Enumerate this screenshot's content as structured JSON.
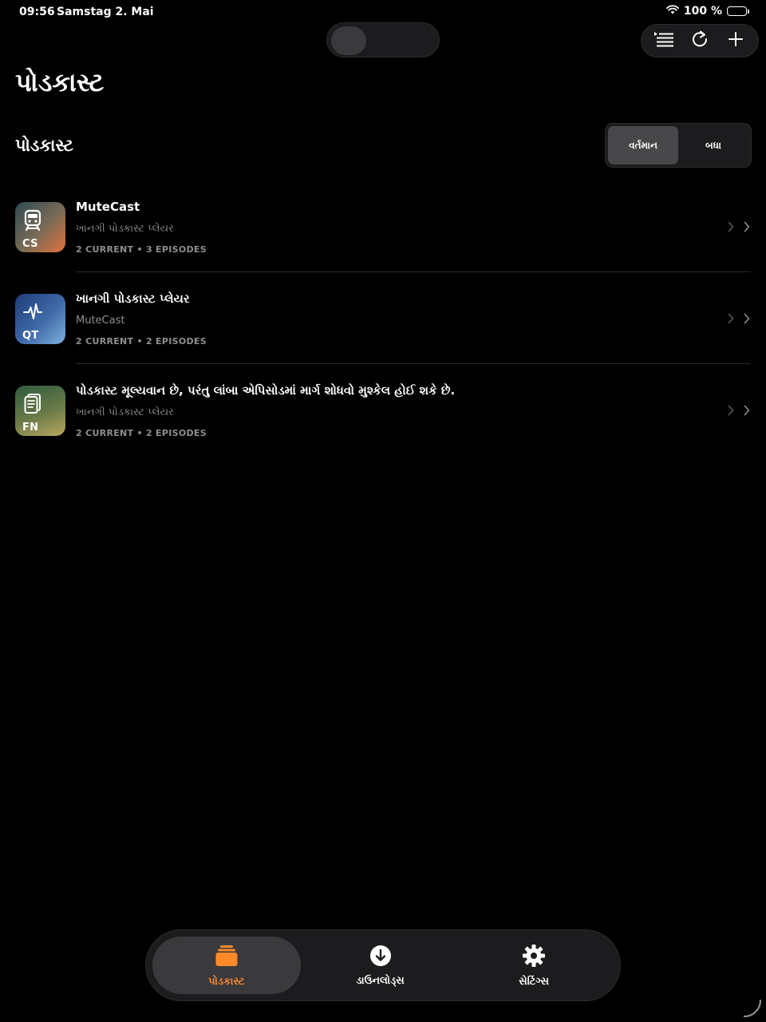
{
  "status_bar": {
    "time": "09:56",
    "date": "Samstag 2. Mai",
    "battery": "100 %"
  },
  "toolbar": {
    "icons": [
      "list-icon",
      "refresh-icon",
      "plus-icon"
    ]
  },
  "page": {
    "title": "પોડકાસ્ટ"
  },
  "section": {
    "title": "પોડકાસ્ટ",
    "segments": [
      {
        "label": "વર્તમાન",
        "active": true
      },
      {
        "label": "બધા",
        "active": false
      }
    ]
  },
  "podcasts": [
    {
      "title": "MuteCast",
      "subtitle": "ખાનગી પોડકાસ્ટ પ્લેયર",
      "meta": "2 CURRENT • 3 EPISODES",
      "art_code": "CS",
      "art_icon": "train-icon"
    },
    {
      "title": "ખાનગી પોડકાસ્ટ પ્લેયર",
      "subtitle": "MuteCast",
      "meta": "2 CURRENT • 2 EPISODES",
      "art_code": "QT",
      "art_icon": "waveform-icon"
    },
    {
      "title": "પોડકાસ્ટ મૂલ્યવાન છે, પરંતુ લાંબા એપિસોડમાં માર્ગ શોધવો મુશ્કેલ હોઈ શકે છે.",
      "subtitle": "ખાનગી પોડકાસ્ટ પ્લેયર",
      "meta": "2 CURRENT • 2 EPISODES",
      "art_code": "FN",
      "art_icon": "document-icon"
    }
  ],
  "tab_bar": {
    "tabs": [
      {
        "label": "પોડકાસ્ટ",
        "icon": "stack-icon",
        "active": true
      },
      {
        "label": "ડાઉનલોડ્સ",
        "icon": "download-icon",
        "active": false
      },
      {
        "label": "સેટિંગ્સ",
        "icon": "gear-icon",
        "active": false
      }
    ]
  },
  "colors": {
    "background": "#000000",
    "accent": "#ff8a2a",
    "secondary_text": "#8e8e93",
    "surface": "#1c1c1e"
  }
}
